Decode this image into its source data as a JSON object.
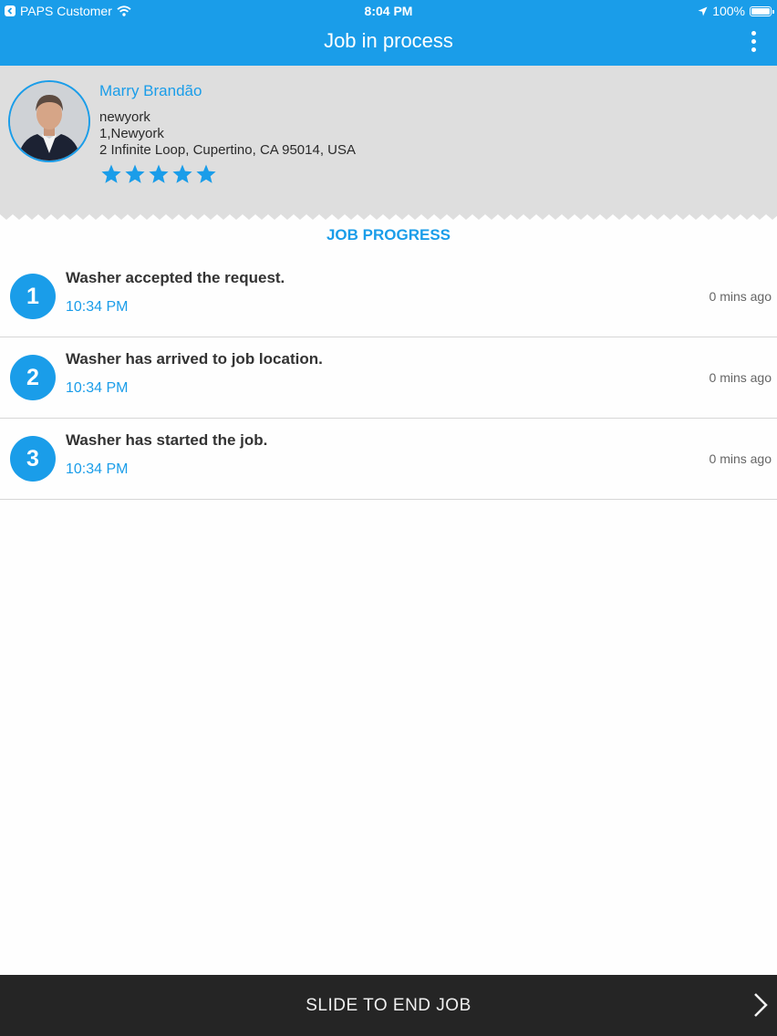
{
  "status_bar": {
    "back_app": "PAPS Customer",
    "time": "8:04 PM",
    "battery": "100%",
    "battery_level": 1.0
  },
  "header": {
    "title": "Job in process",
    "menu_icon": "more-vertical-icon"
  },
  "profile": {
    "name": "Marry Brandão",
    "line1": "newyork",
    "line2": "1,Newyork",
    "address": "2 Infinite Loop,  Cupertino,  CA 95014,  USA",
    "rating": 5,
    "rating_max": 5
  },
  "progress": {
    "title": "JOB PROGRESS",
    "items": [
      {
        "step": "1",
        "text": "Washer accepted the request.",
        "time": "10:34 PM",
        "ago": "0 mins ago"
      },
      {
        "step": "2",
        "text": "Washer has arrived to job location.",
        "time": "10:34 PM",
        "ago": "0 mins ago"
      },
      {
        "step": "3",
        "text": "Washer has started the job.",
        "time": "10:34 PM",
        "ago": "0 mins ago"
      }
    ]
  },
  "footer": {
    "slide_label": "SLIDE TO END JOB"
  },
  "colors": {
    "accent": "#1a9de9",
    "profile_bg": "#dedede",
    "footer_bg": "#252525"
  }
}
